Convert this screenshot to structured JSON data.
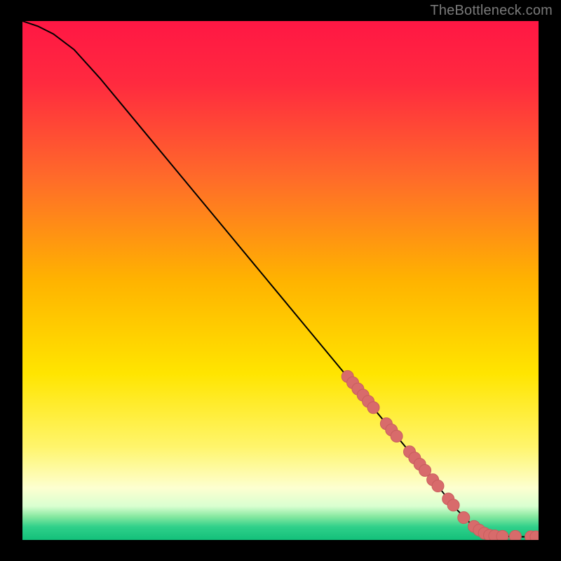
{
  "watermark": "TheBottleneck.com",
  "colors": {
    "background": "#000000",
    "curve": "#000000",
    "marker_fill": "#d86b6b",
    "marker_stroke": "#c85e5e",
    "gradient_stops": [
      {
        "offset": 0.0,
        "color": "#ff1744"
      },
      {
        "offset": 0.12,
        "color": "#ff2a3f"
      },
      {
        "offset": 0.3,
        "color": "#ff6a2a"
      },
      {
        "offset": 0.5,
        "color": "#ffb300"
      },
      {
        "offset": 0.68,
        "color": "#ffe500"
      },
      {
        "offset": 0.82,
        "color": "#fff56b"
      },
      {
        "offset": 0.9,
        "color": "#fdffd0"
      },
      {
        "offset": 0.935,
        "color": "#d9ffd0"
      },
      {
        "offset": 0.955,
        "color": "#86e8a0"
      },
      {
        "offset": 0.975,
        "color": "#2fd08a"
      },
      {
        "offset": 1.0,
        "color": "#13c07a"
      }
    ]
  },
  "chart_data": {
    "type": "line",
    "title": "",
    "xlabel": "",
    "ylabel": "",
    "xlim": [
      0,
      100
    ],
    "ylim": [
      0,
      100
    ],
    "grid": false,
    "legend": false,
    "series": [
      {
        "name": "curve",
        "x": [
          0,
          3,
          6,
          10,
          15,
          20,
          25,
          30,
          35,
          40,
          45,
          50,
          55,
          60,
          65,
          70,
          75,
          80,
          84,
          87,
          89,
          90,
          92,
          94,
          96,
          98,
          100
        ],
        "y": [
          100,
          99,
          97.5,
          94.5,
          89,
          83,
          77,
          71,
          65,
          59,
          53,
          47,
          41,
          35,
          29,
          23,
          17,
          11,
          6,
          3,
          1.5,
          1.0,
          0.8,
          0.7,
          0.6,
          0.6,
          0.6
        ]
      }
    ],
    "markers": [
      {
        "x": 63.0,
        "y": 31.5
      },
      {
        "x": 64.0,
        "y": 30.3
      },
      {
        "x": 65.0,
        "y": 29.1
      },
      {
        "x": 66.0,
        "y": 27.9
      },
      {
        "x": 67.0,
        "y": 26.7
      },
      {
        "x": 68.0,
        "y": 25.5
      },
      {
        "x": 70.5,
        "y": 22.4
      },
      {
        "x": 71.5,
        "y": 21.2
      },
      {
        "x": 72.5,
        "y": 20.0
      },
      {
        "x": 75.0,
        "y": 17.0
      },
      {
        "x": 76.0,
        "y": 15.8
      },
      {
        "x": 77.0,
        "y": 14.6
      },
      {
        "x": 78.0,
        "y": 13.4
      },
      {
        "x": 79.5,
        "y": 11.6
      },
      {
        "x": 80.5,
        "y": 10.4
      },
      {
        "x": 82.5,
        "y": 7.9
      },
      {
        "x": 83.5,
        "y": 6.7
      },
      {
        "x": 85.5,
        "y": 4.3
      },
      {
        "x": 87.5,
        "y": 2.6
      },
      {
        "x": 88.5,
        "y": 1.9
      },
      {
        "x": 89.5,
        "y": 1.3
      },
      {
        "x": 90.5,
        "y": 0.9
      },
      {
        "x": 91.5,
        "y": 0.8
      },
      {
        "x": 93.0,
        "y": 0.7
      },
      {
        "x": 95.5,
        "y": 0.7
      },
      {
        "x": 98.5,
        "y": 0.6
      },
      {
        "x": 99.5,
        "y": 0.6
      }
    ]
  }
}
